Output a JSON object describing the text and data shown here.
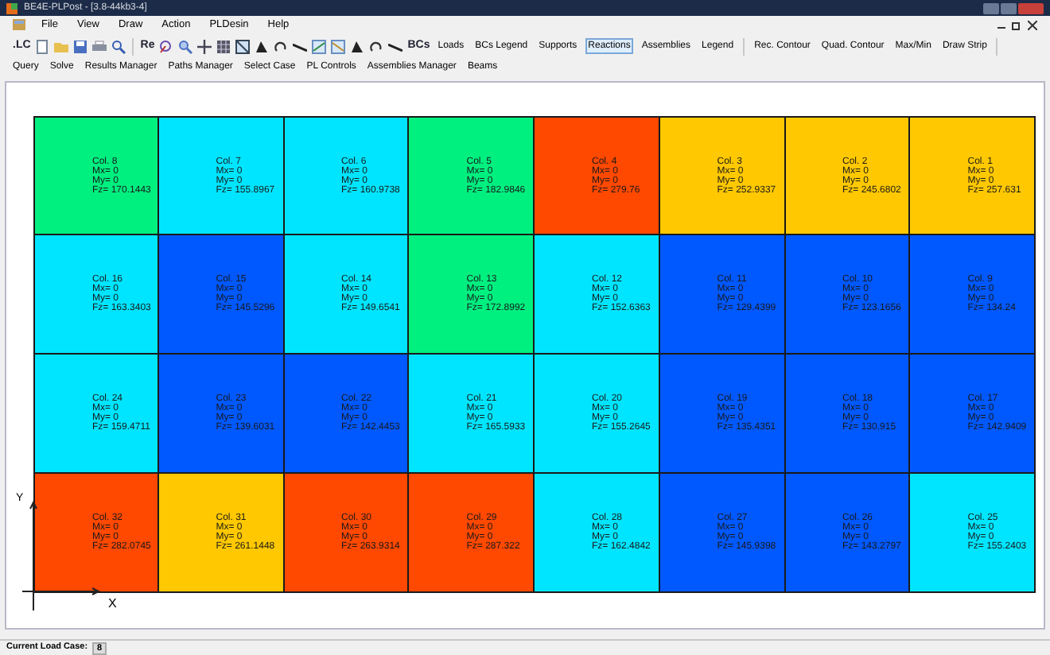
{
  "window": {
    "title": "BE4E-PLPost - [3.8-44kb3-4]"
  },
  "menu": [
    "File",
    "View",
    "Draw",
    "Action",
    "PLDesin",
    "Help"
  ],
  "toolbar_text": [
    ".LC",
    "Re",
    "BCs"
  ],
  "toolbar": [
    {
      "label": "Loads",
      "selected": false
    },
    {
      "label": "BCs Legend",
      "selected": false
    },
    {
      "label": "Supports",
      "selected": false
    },
    {
      "label": "Reactions",
      "selected": true
    },
    {
      "label": "Assemblies",
      "selected": false
    },
    {
      "label": "Legend",
      "selected": false
    },
    {
      "label": "Rec. Contour",
      "selected": false
    },
    {
      "label": "Quad. Contour",
      "selected": false
    },
    {
      "label": "Max/Min",
      "selected": false
    },
    {
      "label": "Draw Strip",
      "selected": false
    }
  ],
  "toolbar2": [
    "Query",
    "Solve",
    "Results Manager",
    "Paths Manager",
    "Select Case",
    "PL Controls",
    "Assemblies Manager",
    "Beams"
  ],
  "cells": [
    {
      "name": "Col. 8",
      "mx": "Mx= 0",
      "my": "My= 0",
      "fz": "Fz= 170.1443",
      "color": "#00f080"
    },
    {
      "name": "Col. 7",
      "mx": "Mx= 0",
      "my": "My= 0",
      "fz": "Fz= 155.8967",
      "color": "#00e5ff"
    },
    {
      "name": "Col. 6",
      "mx": "Mx= 0",
      "my": "My= 0",
      "fz": "Fz= 160.9738",
      "color": "#00e5ff"
    },
    {
      "name": "Col. 5",
      "mx": "Mx= 0",
      "my": "My= 0",
      "fz": "Fz= 182.9846",
      "color": "#00f080"
    },
    {
      "name": "Col. 4",
      "mx": "Mx= 0",
      "my": "My= 0",
      "fz": "Fz= 279.76",
      "color": "#ff4800"
    },
    {
      "name": "Col. 3",
      "mx": "Mx= 0",
      "my": "My= 0",
      "fz": "Fz= 252.9337",
      "color": "#ffc800"
    },
    {
      "name": "Col. 2",
      "mx": "Mx= 0",
      "my": "My= 0",
      "fz": "Fz= 245.6802",
      "color": "#ffc800"
    },
    {
      "name": "Col. 1",
      "mx": "Mx= 0",
      "my": "My= 0",
      "fz": "Fz= 257.631",
      "color": "#ffc800"
    },
    {
      "name": "Col. 16",
      "mx": "Mx= 0",
      "my": "My= 0",
      "fz": "Fz= 163.3403",
      "color": "#00e5ff"
    },
    {
      "name": "Col. 15",
      "mx": "Mx= 0",
      "my": "My= 0",
      "fz": "Fz= 145.5296",
      "color": "#0058ff"
    },
    {
      "name": "Col. 14",
      "mx": "Mx= 0",
      "my": "My= 0",
      "fz": "Fz= 149.6541",
      "color": "#00e5ff"
    },
    {
      "name": "Col. 13",
      "mx": "Mx= 0",
      "my": "My= 0",
      "fz": "Fz= 172.8992",
      "color": "#00f080"
    },
    {
      "name": "Col. 12",
      "mx": "Mx= 0",
      "my": "My= 0",
      "fz": "Fz= 152.6363",
      "color": "#00e5ff"
    },
    {
      "name": "Col. 11",
      "mx": "Mx= 0",
      "my": "My= 0",
      "fz": "Fz= 129.4399",
      "color": "#0058ff"
    },
    {
      "name": "Col. 10",
      "mx": "Mx= 0",
      "my": "My= 0",
      "fz": "Fz= 123.1656",
      "color": "#0058ff"
    },
    {
      "name": "Col. 9",
      "mx": "Mx= 0",
      "my": "My= 0",
      "fz": "Fz= 134.24",
      "color": "#0058ff"
    },
    {
      "name": "Col. 24",
      "mx": "Mx= 0",
      "my": "My= 0",
      "fz": "Fz= 159.4711",
      "color": "#00e5ff"
    },
    {
      "name": "Col. 23",
      "mx": "Mx= 0",
      "my": "My= 0",
      "fz": "Fz= 139.6031",
      "color": "#0058ff"
    },
    {
      "name": "Col. 22",
      "mx": "Mx= 0",
      "my": "My= 0",
      "fz": "Fz= 142.4453",
      "color": "#0058ff"
    },
    {
      "name": "Col. 21",
      "mx": "Mx= 0",
      "my": "My= 0",
      "fz": "Fz= 165.5933",
      "color": "#00e5ff"
    },
    {
      "name": "Col. 20",
      "mx": "Mx= 0",
      "my": "My= 0",
      "fz": "Fz= 155.2645",
      "color": "#00e5ff"
    },
    {
      "name": "Col. 19",
      "mx": "Mx= 0",
      "my": "My= 0",
      "fz": "Fz= 135.4351",
      "color": "#0058ff"
    },
    {
      "name": "Col. 18",
      "mx": "Mx= 0",
      "my": "My= 0",
      "fz": "Fz= 130.915",
      "color": "#0058ff"
    },
    {
      "name": "Col. 17",
      "mx": "Mx= 0",
      "my": "My= 0",
      "fz": "Fz= 142.9409",
      "color": "#0058ff"
    },
    {
      "name": "Col. 32",
      "mx": "Mx= 0",
      "my": "My= 0",
      "fz": "Fz= 282.0745",
      "color": "#ff4800"
    },
    {
      "name": "Col. 31",
      "mx": "Mx= 0",
      "my": "My= 0",
      "fz": "Fz= 261.1448",
      "color": "#ffc800"
    },
    {
      "name": "Col. 30",
      "mx": "Mx= 0",
      "my": "My= 0",
      "fz": "Fz= 263.9314",
      "color": "#ff4800"
    },
    {
      "name": "Col. 29",
      "mx": "Mx= 0",
      "my": "My= 0",
      "fz": "Fz= 287.322",
      "color": "#ff4800"
    },
    {
      "name": "Col. 28",
      "mx": "Mx= 0",
      "my": "My= 0",
      "fz": "Fz= 162.4842",
      "color": "#00e5ff"
    },
    {
      "name": "Col. 27",
      "mx": "Mx= 0",
      "my": "My= 0",
      "fz": "Fz= 145.9398",
      "color": "#0058ff"
    },
    {
      "name": "Col. 26",
      "mx": "Mx= 0",
      "my": "My= 0",
      "fz": "Fz= 143.2797",
      "color": "#0058ff"
    },
    {
      "name": "Col. 25",
      "mx": "Mx= 0",
      "my": "My= 0",
      "fz": "Fz= 155.2403",
      "color": "#00e5ff"
    }
  ],
  "axes": {
    "y": "Y",
    "x": "X"
  },
  "status_bar": {
    "label": "Current Load Case:",
    "value": "8"
  }
}
